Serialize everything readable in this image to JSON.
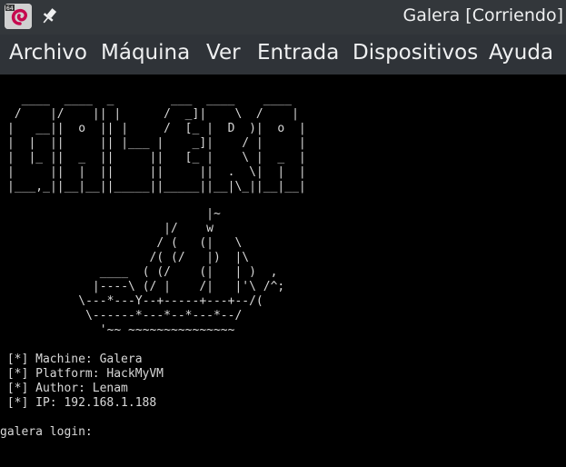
{
  "window": {
    "title": "Galera [Corriendo]"
  },
  "menu": [
    {
      "id": "archivo",
      "label": "Archivo"
    },
    {
      "id": "maquina",
      "label": "Máquina"
    },
    {
      "id": "ver",
      "label": "Ver"
    },
    {
      "id": "entrada",
      "label": "Entrada"
    },
    {
      "id": "dispositivos",
      "label": "Dispositivos"
    },
    {
      "id": "ayuda",
      "label": "Ayuda"
    }
  ],
  "icons": {
    "app": "virtualbox-vm-icon",
    "pin": "pin-icon"
  },
  "terminal": {
    "banner_art": "  ____  ____  _        ___  ____    ____ \n /    |/    || |      /  _]|    \\  /    |\n|   __||  o  || |     /  [_ |  D  )|  o  |\n|  |  ||     || |___ |    _]|    / |     |\n|  |_ ||  _  ||     ||   [_ |    \\ |  _  |\n|     ||  |  ||     ||     ||  .  \\|  |  |\n|___,_||__|__||_____||_____||__|\\_||__|__|",
    "ship_art": "                            |~\n                      |/    w\n                     / (   (|   \\\n                    /( (/   |)  |\\\n             ____  ( (/    (|   | )  ,\n            |----\\ (/ |    /|   |'\\ /^;\n          \\---*---Y--+-----+---+--/(\n           \\------*---*--*---*--/\n             '~~ ~~~~~~~~~~~~~~~",
    "info_lines": [
      " [*] Machine: Galera",
      " [*] Platform: HackMyVM",
      " [*] Author: Lenam",
      " [*] IP: 192.168.1.188"
    ],
    "login_prompt": "galera login: "
  }
}
